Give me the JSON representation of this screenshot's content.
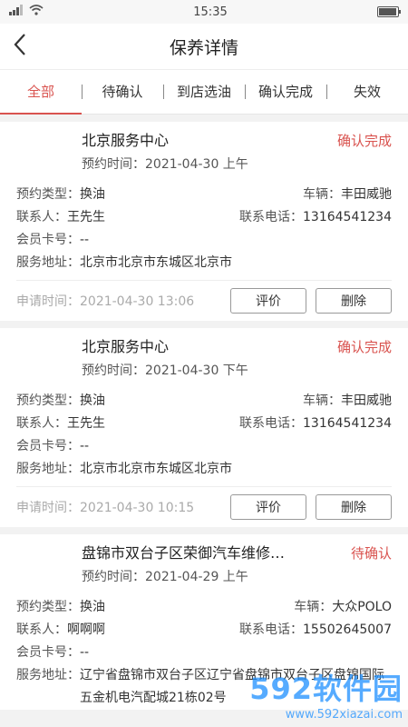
{
  "status_bar": {
    "time": "15:35"
  },
  "header": {
    "title": "保养详情"
  },
  "tabs": [
    {
      "label": "全部"
    },
    {
      "label": "待确认"
    },
    {
      "label": "到店选油"
    },
    {
      "label": "确认完成"
    },
    {
      "label": "失效"
    }
  ],
  "labels": {
    "appointment_prefix": "预约时间：",
    "type": "预约类型：",
    "vehicle": "车辆：",
    "contact": "联系人：",
    "phone": "联系电话：",
    "member": "会员卡号：",
    "address": "服务地址：",
    "apply_prefix": "申请时间：",
    "review_button": "评价",
    "delete_button": "删除"
  },
  "orders": [
    {
      "shop": "北京服务中心",
      "status": "确认完成",
      "status_color": "#d9534f",
      "appointment": "2021-04-30 上午",
      "type": "换油",
      "vehicle": "丰田威驰",
      "contact": "王先生",
      "phone": "13164541234",
      "member_card": "--",
      "address": "北京市北京市东城区北京市",
      "apply_time": "2021-04-30 13:06"
    },
    {
      "shop": "北京服务中心",
      "status": "确认完成",
      "status_color": "#d9534f",
      "appointment": "2021-04-30 下午",
      "type": "换油",
      "vehicle": "丰田威驰",
      "contact": "王先生",
      "phone": "13164541234",
      "member_card": "--",
      "address": "北京市北京市东城区北京市",
      "apply_time": "2021-04-30 10:15"
    },
    {
      "shop": "盘锦市双台子区荣御汽车维修…",
      "status": "待确认",
      "status_color": "#d9534f",
      "appointment": "2021-04-29 上午",
      "type": "换油",
      "vehicle": "大众POLO",
      "contact": "啊啊啊",
      "phone": "15502645007",
      "member_card": "--",
      "address": "辽宁省盘锦市双台子区辽宁省盘锦市双台子区盘锦国际五金机电汽配城21栋02号"
    }
  ],
  "watermark": {
    "main": "592软件园",
    "sub": "www.592xiazai.com"
  }
}
